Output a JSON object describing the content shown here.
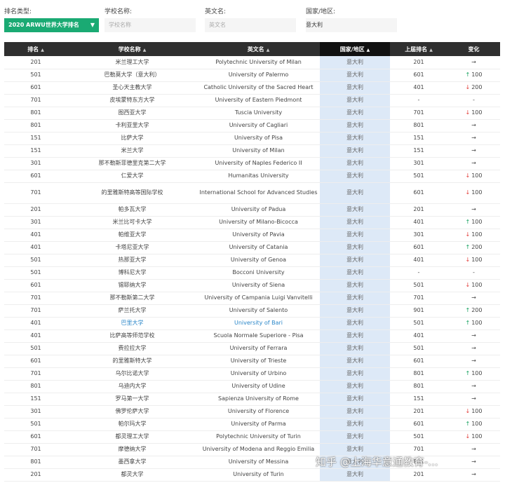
{
  "filters": {
    "rank_type": {
      "label": "排名类型:",
      "value": "2020 ARWU世界大学排名"
    },
    "school": {
      "label": "学校名称:",
      "placeholder": "学校名称"
    },
    "english": {
      "label": "英文名:",
      "placeholder": "英文名"
    },
    "country": {
      "label": "国家/地区:",
      "value": "意大利"
    }
  },
  "table": {
    "headers": {
      "rank": "排名",
      "cname": "学校名称",
      "ename": "英文名",
      "country": "国家/地区",
      "prev": "上届排名",
      "change": "变化"
    },
    "rows": [
      {
        "rank": "201",
        "cname": "米兰理工大学",
        "ename": "Polytechnic University of Milan",
        "country": "意大利",
        "prev": "201",
        "dir": "",
        "arrow": "→",
        "amount": ""
      },
      {
        "rank": "501",
        "cname": "巴勒莫大学（意大利）",
        "ename": "University of Palermo",
        "country": "意大利",
        "prev": "601",
        "dir": "up",
        "arrow": "↑",
        "amount": "100"
      },
      {
        "rank": "601",
        "cname": "圣心天主教大学",
        "ename": "Catholic University of the Sacred Heart",
        "country": "意大利",
        "prev": "401",
        "dir": "down",
        "arrow": "↓",
        "amount": "200"
      },
      {
        "rank": "701",
        "cname": "皮埃蒙特东方大学",
        "ename": "University of Eastern Piedmont",
        "country": "意大利",
        "prev": "-",
        "dir": "",
        "arrow": "",
        "amount": "-"
      },
      {
        "rank": "801",
        "cname": "图西亚大学",
        "ename": "Tuscia University",
        "country": "意大利",
        "prev": "701",
        "dir": "down",
        "arrow": "↓",
        "amount": "100"
      },
      {
        "rank": "801",
        "cname": "卡利亚里大学",
        "ename": "University of Cagliari",
        "country": "意大利",
        "prev": "801",
        "dir": "",
        "arrow": "→",
        "amount": ""
      },
      {
        "rank": "151",
        "cname": "比萨大学",
        "ename": "University of Pisa",
        "country": "意大利",
        "prev": "151",
        "dir": "",
        "arrow": "→",
        "amount": ""
      },
      {
        "rank": "151",
        "cname": "米兰大学",
        "ename": "University of Milan",
        "country": "意大利",
        "prev": "151",
        "dir": "",
        "arrow": "→",
        "amount": ""
      },
      {
        "rank": "301",
        "cname": "那不勒斯菲德里克第二大学",
        "ename": "University of Naples Federico II",
        "country": "意大利",
        "prev": "301",
        "dir": "",
        "arrow": "→",
        "amount": ""
      },
      {
        "rank": "601",
        "cname": "仁爱大学",
        "ename": "Humanitas University",
        "country": "意大利",
        "prev": "501",
        "dir": "down",
        "arrow": "↓",
        "amount": "100"
      },
      {
        "rank": "701",
        "cname": "的里雅斯特高等国际学校",
        "ename": "International School for Advanced Studies",
        "country": "意大利",
        "prev": "601",
        "dir": "down",
        "arrow": "↓",
        "amount": "100",
        "tall": true
      },
      {
        "rank": "201",
        "cname": "帕多瓦大学",
        "ename": "University of Padua",
        "country": "意大利",
        "prev": "201",
        "dir": "",
        "arrow": "→",
        "amount": ""
      },
      {
        "rank": "301",
        "cname": "米兰比可卡大学",
        "ename": "University of Milano-Bicocca",
        "country": "意大利",
        "prev": "401",
        "dir": "up",
        "arrow": "↑",
        "amount": "100"
      },
      {
        "rank": "401",
        "cname": "帕维亚大学",
        "ename": "University of Pavia",
        "country": "意大利",
        "prev": "301",
        "dir": "down",
        "arrow": "↓",
        "amount": "100"
      },
      {
        "rank": "401",
        "cname": "卡塔尼亚大学",
        "ename": "University of Catania",
        "country": "意大利",
        "prev": "601",
        "dir": "up",
        "arrow": "↑",
        "amount": "200"
      },
      {
        "rank": "501",
        "cname": "热那亚大学",
        "ename": "University of Genoa",
        "country": "意大利",
        "prev": "401",
        "dir": "down",
        "arrow": "↓",
        "amount": "100"
      },
      {
        "rank": "501",
        "cname": "博科尼大学",
        "ename": "Bocconi University",
        "country": "意大利",
        "prev": "-",
        "dir": "",
        "arrow": "",
        "amount": "-"
      },
      {
        "rank": "601",
        "cname": "锡耶纳大学",
        "ename": "University of Siena",
        "country": "意大利",
        "prev": "501",
        "dir": "down",
        "arrow": "↓",
        "amount": "100"
      },
      {
        "rank": "701",
        "cname": "那不勒斯第二大学",
        "ename": "University of Campania Luigi Vanvitelli",
        "country": "意大利",
        "prev": "701",
        "dir": "",
        "arrow": "→",
        "amount": ""
      },
      {
        "rank": "701",
        "cname": "萨兰托大学",
        "ename": "University of Salento",
        "country": "意大利",
        "prev": "901",
        "dir": "up",
        "arrow": "↑",
        "amount": "200"
      },
      {
        "rank": "401",
        "cname": "巴里大学",
        "ename": "University of Bari",
        "country": "意大利",
        "prev": "501",
        "dir": "up",
        "arrow": "↑",
        "amount": "100",
        "link": true
      },
      {
        "rank": "401",
        "cname": "比萨高等师范学校",
        "ename": "Scuola Normale Superiore - Pisa",
        "country": "意大利",
        "prev": "401",
        "dir": "",
        "arrow": "→",
        "amount": ""
      },
      {
        "rank": "501",
        "cname": "费拉拉大学",
        "ename": "University of Ferrara",
        "country": "意大利",
        "prev": "501",
        "dir": "",
        "arrow": "→",
        "amount": ""
      },
      {
        "rank": "601",
        "cname": "的里雅斯特大学",
        "ename": "University of Trieste",
        "country": "意大利",
        "prev": "601",
        "dir": "",
        "arrow": "→",
        "amount": ""
      },
      {
        "rank": "701",
        "cname": "乌尔比诺大学",
        "ename": "University of Urbino",
        "country": "意大利",
        "prev": "801",
        "dir": "up",
        "arrow": "↑",
        "amount": "100"
      },
      {
        "rank": "801",
        "cname": "乌迪内大学",
        "ename": "University of Udine",
        "country": "意大利",
        "prev": "801",
        "dir": "",
        "arrow": "→",
        "amount": ""
      },
      {
        "rank": "151",
        "cname": "罗马第一大学",
        "ename": "Sapienza University of Rome",
        "country": "意大利",
        "prev": "151",
        "dir": "",
        "arrow": "→",
        "amount": ""
      },
      {
        "rank": "301",
        "cname": "佛罗伦萨大学",
        "ename": "University of Florence",
        "country": "意大利",
        "prev": "201",
        "dir": "down",
        "arrow": "↓",
        "amount": "100"
      },
      {
        "rank": "501",
        "cname": "帕尔玛大学",
        "ename": "University of Parma",
        "country": "意大利",
        "prev": "601",
        "dir": "up",
        "arrow": "↑",
        "amount": "100"
      },
      {
        "rank": "601",
        "cname": "都灵理工大学",
        "ename": "Polytechnic University of Turin",
        "country": "意大利",
        "prev": "501",
        "dir": "down",
        "arrow": "↓",
        "amount": "100"
      },
      {
        "rank": "701",
        "cname": "摩德纳大学",
        "ename": "University of Modena and Reggio Emilia",
        "country": "意大利",
        "prev": "701",
        "dir": "",
        "arrow": "→",
        "amount": ""
      },
      {
        "rank": "801",
        "cname": "墨西拿大学",
        "ename": "University of Messina",
        "country": "意大利",
        "prev": "801",
        "dir": "",
        "arrow": "→",
        "amount": ""
      },
      {
        "rank": "201",
        "cname": "都灵大学",
        "ename": "University of Turin",
        "country": "意大利",
        "prev": "201",
        "dir": "",
        "arrow": "→",
        "amount": ""
      }
    ]
  },
  "watermark": "知乎 @上海华意通教育-..."
}
